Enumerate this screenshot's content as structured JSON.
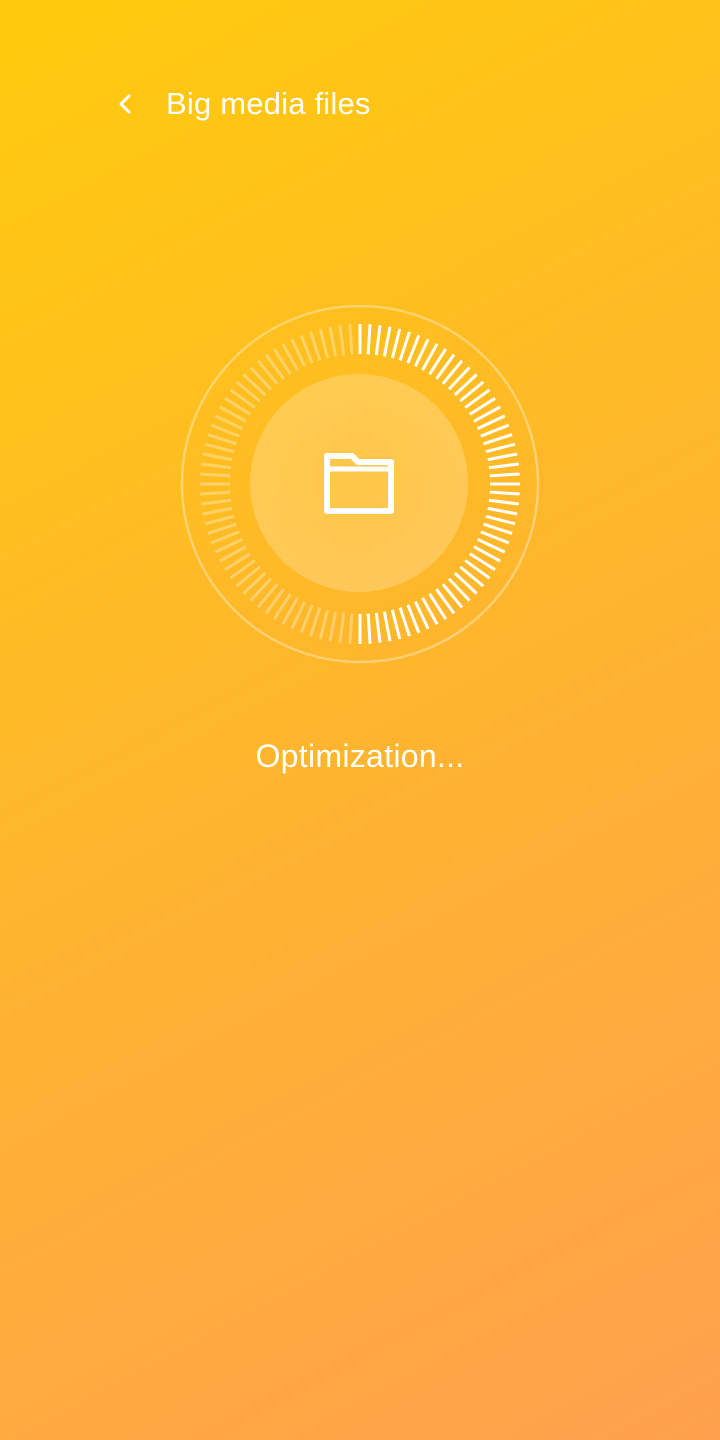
{
  "header": {
    "title": "Big media files",
    "back_icon": "chevron-left-icon"
  },
  "scan": {
    "progress": 0.5,
    "center_icon": "folder-icon",
    "status_text": "Optimization..."
  },
  "colors": {
    "gradient_start": "#FFCB0C",
    "gradient_end": "#FFA04E",
    "foreground": "#FFFFFF"
  }
}
